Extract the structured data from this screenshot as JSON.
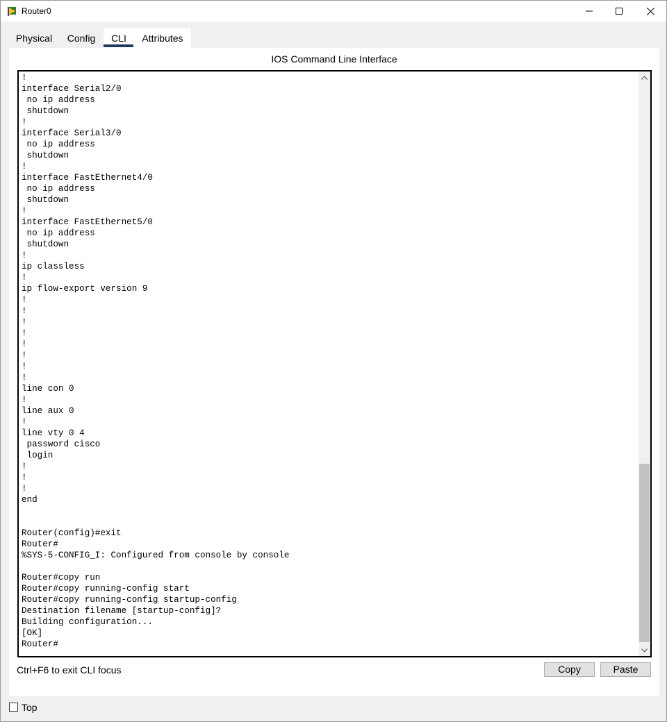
{
  "window": {
    "title": "Router0",
    "icon": "router-app-icon",
    "controls": [
      "minimize-icon",
      "maximize-icon",
      "close-icon"
    ]
  },
  "tabs": [
    {
      "label": "Physical",
      "active": false
    },
    {
      "label": "Config",
      "active": false
    },
    {
      "label": "CLI",
      "active": true
    },
    {
      "label": "Attributes",
      "active": false
    }
  ],
  "cli": {
    "heading": "IOS Command Line Interface",
    "lines": [
      " shutdown",
      "!",
      "interface Serial2/0",
      " no ip address",
      " shutdown",
      "!",
      "interface Serial3/0",
      " no ip address",
      " shutdown",
      "!",
      "interface FastEthernet4/0",
      " no ip address",
      " shutdown",
      "!",
      "interface FastEthernet5/0",
      " no ip address",
      " shutdown",
      "!",
      "ip classless",
      "!",
      "ip flow-export version 9",
      "!",
      "!",
      "!",
      "!",
      "!",
      "!",
      "!",
      "!",
      "line con 0",
      "!",
      "line aux 0",
      "!",
      "line vty 0 4",
      " password cisco",
      " login",
      "!",
      "!",
      "!",
      "end",
      "",
      "",
      "Router(config)#exit",
      "Router#",
      "%SYS-5-CONFIG_I: Configured from console by console",
      "",
      "Router#copy run",
      "Router#copy running-config start",
      "Router#copy running-config startup-config",
      "Destination filename [startup-config]?",
      "Building configuration...",
      "[OK]",
      "Router#"
    ],
    "hint": "Ctrl+F6 to exit CLI focus",
    "copy_label": "Copy",
    "paste_label": "Paste",
    "scroll_position": 0.99
  },
  "footer": {
    "top_label": "Top",
    "top_checked": false
  }
}
